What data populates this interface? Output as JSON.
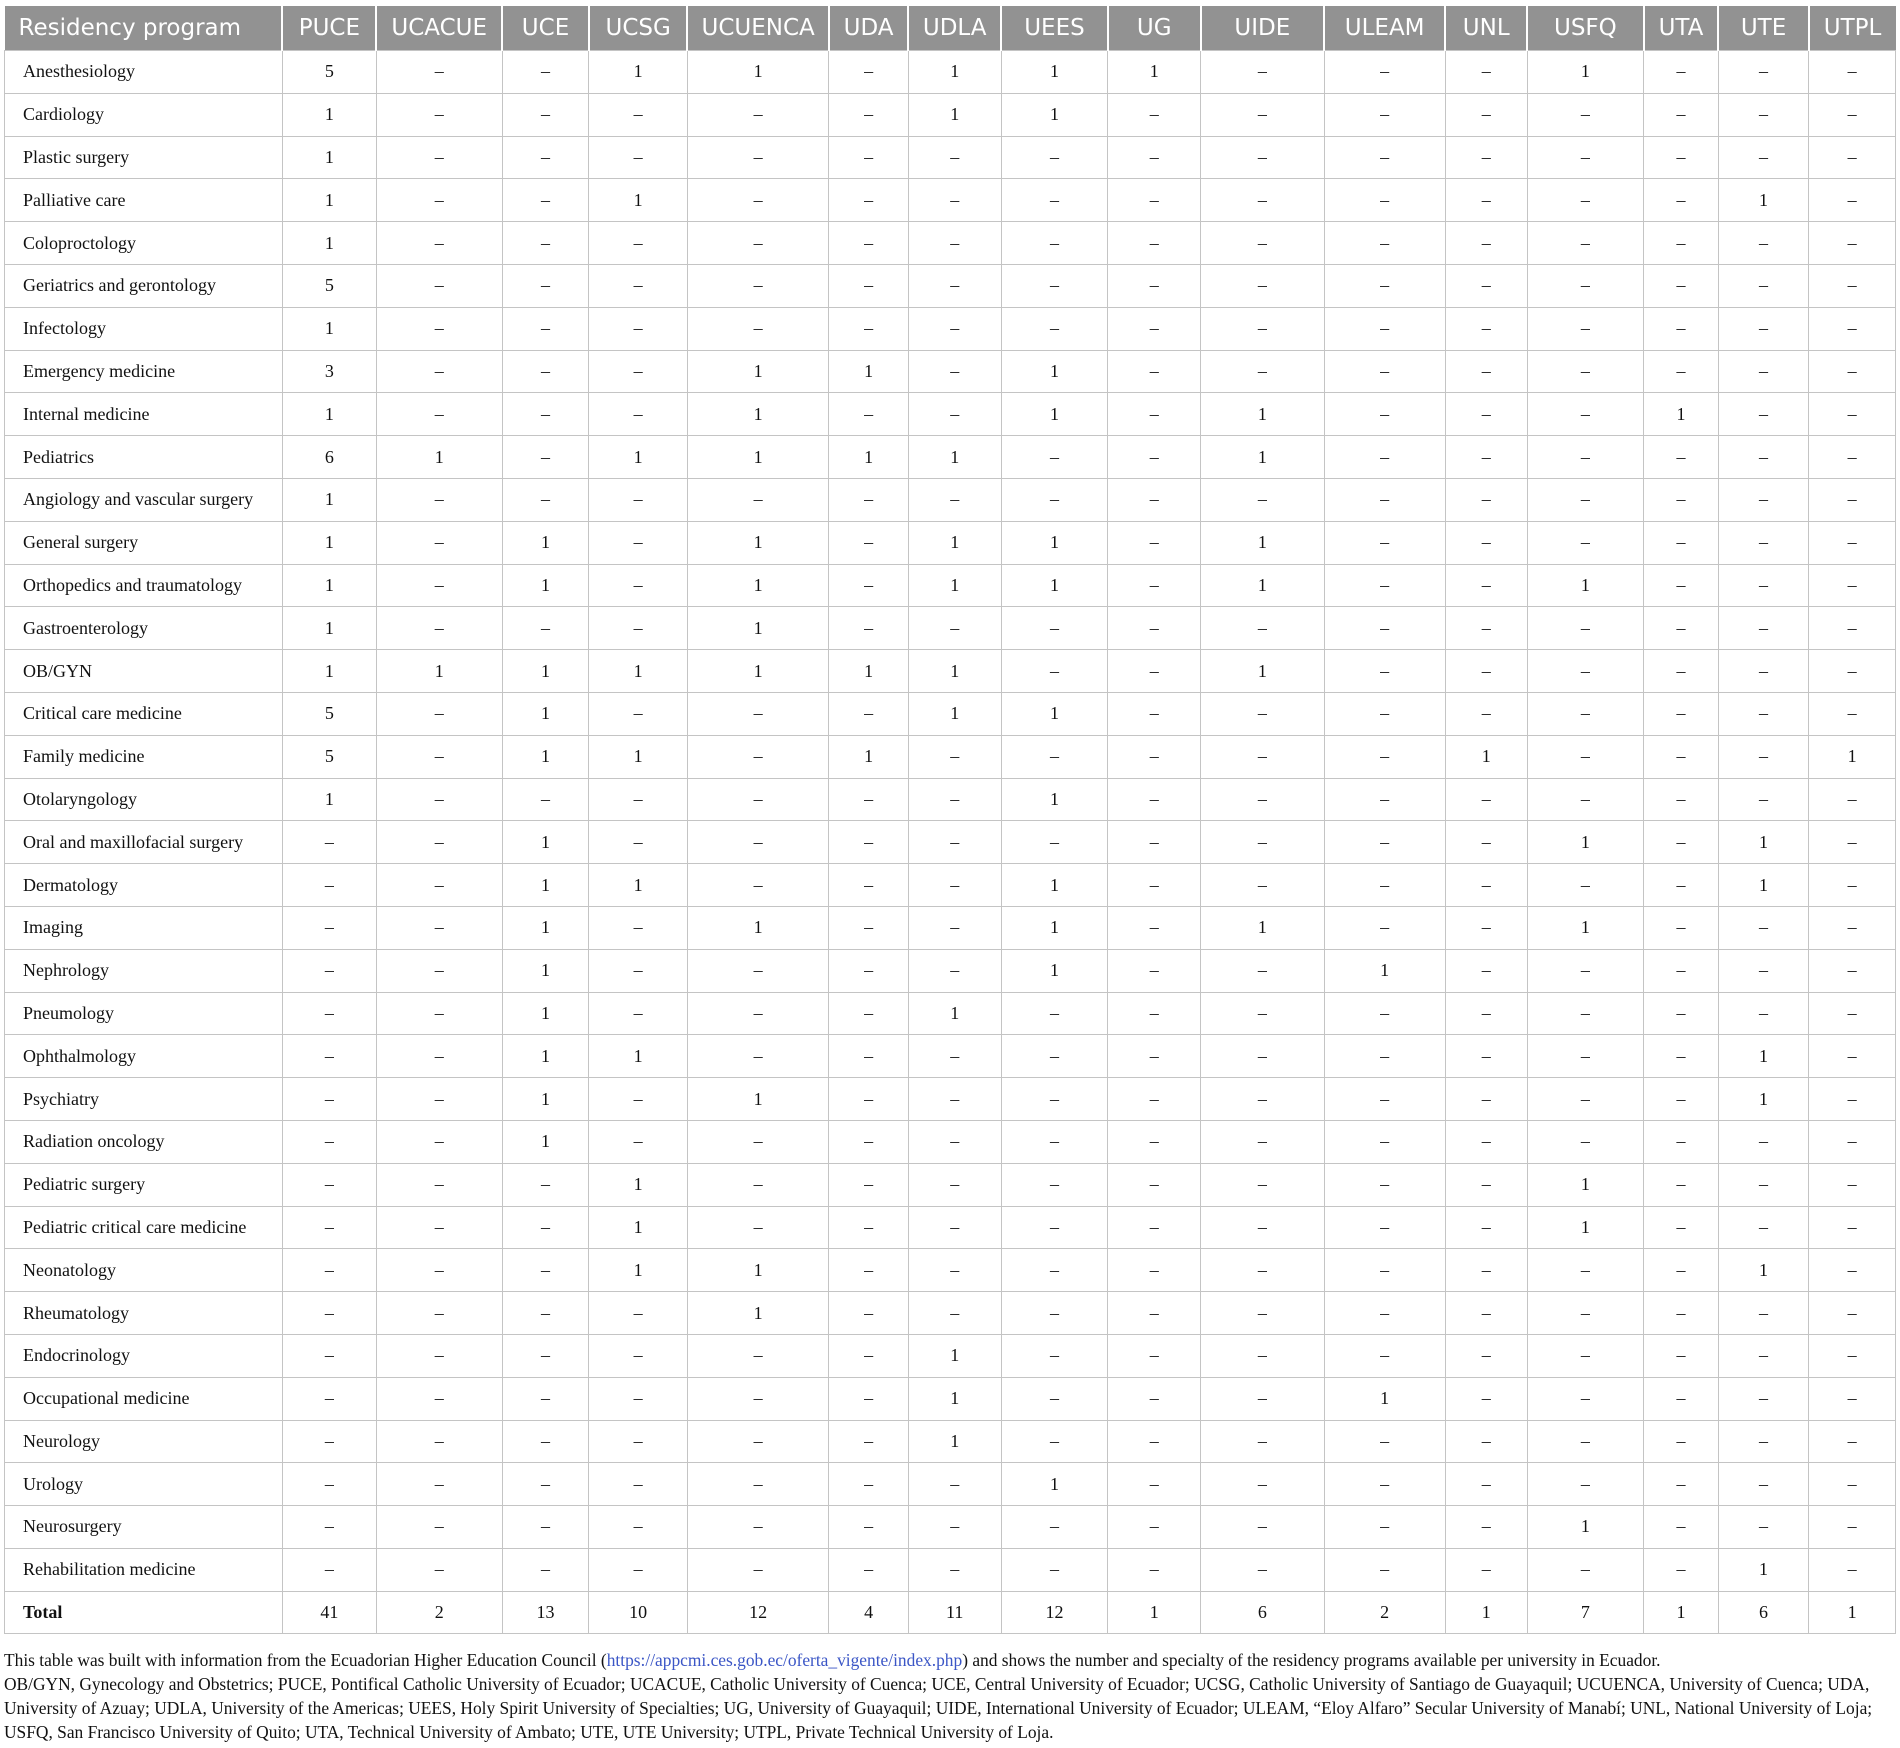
{
  "table": {
    "columns": [
      "Residency program",
      "PUCE",
      "UCACUE",
      "UCE",
      "UCSG",
      "UCUENCA",
      "UDA",
      "UDLA",
      "UEES",
      "UG",
      "UIDE",
      "ULEAM",
      "UNL",
      "USFQ",
      "UTA",
      "UTE",
      "UTPL"
    ],
    "rows": [
      [
        "Anesthesiology",
        "5",
        "–",
        "–",
        "1",
        "1",
        "–",
        "1",
        "1",
        "1",
        "–",
        "–",
        "–",
        "1",
        "–",
        "–",
        "–"
      ],
      [
        "Cardiology",
        "1",
        "–",
        "–",
        "–",
        "–",
        "–",
        "1",
        "1",
        "–",
        "–",
        "–",
        "–",
        "–",
        "–",
        "–",
        "–"
      ],
      [
        "Plastic surgery",
        "1",
        "–",
        "–",
        "–",
        "–",
        "–",
        "–",
        "–",
        "–",
        "–",
        "–",
        "–",
        "–",
        "–",
        "–",
        "–"
      ],
      [
        "Palliative care",
        "1",
        "–",
        "–",
        "1",
        "–",
        "–",
        "–",
        "–",
        "–",
        "–",
        "–",
        "–",
        "–",
        "–",
        "1",
        "–"
      ],
      [
        "Coloproctology",
        "1",
        "–",
        "–",
        "–",
        "–",
        "–",
        "–",
        "–",
        "–",
        "–",
        "–",
        "–",
        "–",
        "–",
        "–",
        "–"
      ],
      [
        "Geriatrics and gerontology",
        "5",
        "–",
        "–",
        "–",
        "–",
        "–",
        "–",
        "–",
        "–",
        "–",
        "–",
        "–",
        "–",
        "–",
        "–",
        "–"
      ],
      [
        "Infectology",
        "1",
        "–",
        "–",
        "–",
        "–",
        "–",
        "–",
        "–",
        "–",
        "–",
        "–",
        "–",
        "–",
        "–",
        "–",
        "–"
      ],
      [
        "Emergency medicine",
        "3",
        "–",
        "–",
        "–",
        "1",
        "1",
        "–",
        "1",
        "–",
        "–",
        "–",
        "–",
        "–",
        "–",
        "–",
        "–"
      ],
      [
        "Internal medicine",
        "1",
        "–",
        "–",
        "–",
        "1",
        "–",
        "–",
        "1",
        "–",
        "1",
        "–",
        "–",
        "–",
        "1",
        "–",
        "–"
      ],
      [
        "Pediatrics",
        "6",
        "1",
        "–",
        "1",
        "1",
        "1",
        "1",
        "–",
        "–",
        "1",
        "–",
        "–",
        "–",
        "–",
        "–",
        "–"
      ],
      [
        "Angiology and vascular surgery",
        "1",
        "–",
        "–",
        "–",
        "–",
        "–",
        "–",
        "–",
        "–",
        "–",
        "–",
        "–",
        "–",
        "–",
        "–",
        "–"
      ],
      [
        "General surgery",
        "1",
        "–",
        "1",
        "–",
        "1",
        "–",
        "1",
        "1",
        "–",
        "1",
        "–",
        "–",
        "–",
        "–",
        "–",
        "–"
      ],
      [
        "Orthopedics and traumatology",
        "1",
        "–",
        "1",
        "–",
        "1",
        "–",
        "1",
        "1",
        "–",
        "1",
        "–",
        "–",
        "1",
        "–",
        "–",
        "–"
      ],
      [
        "Gastroenterology",
        "1",
        "–",
        "–",
        "–",
        "1",
        "–",
        "–",
        "–",
        "–",
        "–",
        "–",
        "–",
        "–",
        "–",
        "–",
        "–"
      ],
      [
        "OB/GYN",
        "1",
        "1",
        "1",
        "1",
        "1",
        "1",
        "1",
        "–",
        "–",
        "1",
        "–",
        "–",
        "–",
        "–",
        "–",
        "–"
      ],
      [
        "Critical care medicine",
        "5",
        "–",
        "1",
        "–",
        "–",
        "–",
        "1",
        "1",
        "–",
        "–",
        "–",
        "–",
        "–",
        "–",
        "–",
        "–"
      ],
      [
        "Family medicine",
        "5",
        "–",
        "1",
        "1",
        "–",
        "1",
        "–",
        "–",
        "–",
        "–",
        "–",
        "1",
        "–",
        "–",
        "–",
        "1"
      ],
      [
        "Otolaryngology",
        "1",
        "–",
        "–",
        "–",
        "–",
        "–",
        "–",
        "1",
        "–",
        "–",
        "–",
        "–",
        "–",
        "–",
        "–",
        "–"
      ],
      [
        "Oral and maxillofacial surgery",
        "–",
        "–",
        "1",
        "–",
        "–",
        "–",
        "–",
        "–",
        "–",
        "–",
        "–",
        "–",
        "1",
        "–",
        "1",
        "–"
      ],
      [
        "Dermatology",
        "–",
        "–",
        "1",
        "1",
        "–",
        "–",
        "–",
        "1",
        "–",
        "–",
        "–",
        "–",
        "–",
        "–",
        "1",
        "–"
      ],
      [
        "Imaging",
        "–",
        "–",
        "1",
        "–",
        "1",
        "–",
        "–",
        "1",
        "–",
        "1",
        "–",
        "–",
        "1",
        "–",
        "–",
        "–"
      ],
      [
        "Nephrology",
        "–",
        "–",
        "1",
        "–",
        "–",
        "–",
        "–",
        "1",
        "–",
        "–",
        "1",
        "–",
        "–",
        "–",
        "–",
        "–"
      ],
      [
        "Pneumology",
        "–",
        "–",
        "1",
        "–",
        "–",
        "–",
        "1",
        "–",
        "–",
        "–",
        "–",
        "–",
        "–",
        "–",
        "–",
        "–"
      ],
      [
        "Ophthalmology",
        "–",
        "–",
        "1",
        "1",
        "–",
        "–",
        "–",
        "–",
        "–",
        "–",
        "–",
        "–",
        "–",
        "–",
        "1",
        "–"
      ],
      [
        "Psychiatry",
        "–",
        "–",
        "1",
        "–",
        "1",
        "–",
        "–",
        "–",
        "–",
        "–",
        "–",
        "–",
        "–",
        "–",
        "1",
        "–"
      ],
      [
        "Radiation oncology",
        "–",
        "–",
        "1",
        "–",
        "–",
        "–",
        "–",
        "–",
        "–",
        "–",
        "–",
        "–",
        "–",
        "–",
        "–",
        "–"
      ],
      [
        "Pediatric surgery",
        "–",
        "–",
        "–",
        "1",
        "–",
        "–",
        "–",
        "–",
        "–",
        "–",
        "–",
        "–",
        "1",
        "–",
        "–",
        "–"
      ],
      [
        "Pediatric critical care medicine",
        "–",
        "–",
        "–",
        "1",
        "–",
        "–",
        "–",
        "–",
        "–",
        "–",
        "–",
        "–",
        "1",
        "–",
        "–",
        "–"
      ],
      [
        "Neonatology",
        "–",
        "–",
        "–",
        "1",
        "1",
        "–",
        "–",
        "–",
        "–",
        "–",
        "–",
        "–",
        "–",
        "–",
        "1",
        "–"
      ],
      [
        "Rheumatology",
        "–",
        "–",
        "–",
        "–",
        "1",
        "–",
        "–",
        "–",
        "–",
        "–",
        "–",
        "–",
        "–",
        "–",
        "–",
        "–"
      ],
      [
        "Endocrinology",
        "–",
        "–",
        "–",
        "–",
        "–",
        "–",
        "1",
        "–",
        "–",
        "–",
        "–",
        "–",
        "–",
        "–",
        "–",
        "–"
      ],
      [
        "Occupational medicine",
        "–",
        "–",
        "–",
        "–",
        "–",
        "–",
        "1",
        "–",
        "–",
        "–",
        "1",
        "–",
        "–",
        "–",
        "–",
        "–"
      ],
      [
        "Neurology",
        "–",
        "–",
        "–",
        "–",
        "–",
        "–",
        "1",
        "–",
        "–",
        "–",
        "–",
        "–",
        "–",
        "–",
        "–",
        "–"
      ],
      [
        "Urology",
        "–",
        "–",
        "–",
        "–",
        "–",
        "–",
        "–",
        "1",
        "–",
        "–",
        "–",
        "–",
        "–",
        "–",
        "–",
        "–"
      ],
      [
        "Neurosurgery",
        "–",
        "–",
        "–",
        "–",
        "–",
        "–",
        "–",
        "–",
        "–",
        "–",
        "–",
        "–",
        "1",
        "–",
        "–",
        "–"
      ],
      [
        "Rehabilitation medicine",
        "–",
        "–",
        "–",
        "–",
        "–",
        "–",
        "–",
        "–",
        "–",
        "–",
        "–",
        "–",
        "–",
        "–",
        "1",
        "–"
      ]
    ],
    "total": [
      "Total",
      "41",
      "2",
      "13",
      "10",
      "12",
      "4",
      "11",
      "12",
      "1",
      "6",
      "2",
      "1",
      "7",
      "1",
      "6",
      "1"
    ]
  },
  "notes": {
    "source_prefix": "This table was built with information from the Ecuadorian Higher Education Council (",
    "source_link": "https://appcmi.ces.gob.ec/oferta_vigente/index.php",
    "source_suffix": ") and shows the number and specialty of the residency programs available per university in Ecuador.",
    "abbreviations": "OB/GYN, Gynecology and Obstetrics; PUCE, Pontifical Catholic University of Ecuador; UCACUE, Catholic University of Cuenca; UCE, Central University of Ecuador; UCSG, Catholic University of Santiago de Guayaquil; UCUENCA, University of Cuenca; UDA, University of Azuay; UDLA, University of the Americas; UEES, Holy Spirit University of Specialties; UG, University of Guayaquil; UIDE, International University of Ecuador; ULEAM, “Eloy Alfaro” Secular University of Manabí; UNL, National University of Loja; USFQ, San Francisco University of Quito; UTA, Technical University of Ambato; UTE, UTE University; UTPL, Private Technical University of Loja."
  },
  "colors": {
    "header_bg": "#929292",
    "header_text": "#ffffff",
    "grid_line": "#c4c4c4",
    "link": "#3b56c6"
  }
}
